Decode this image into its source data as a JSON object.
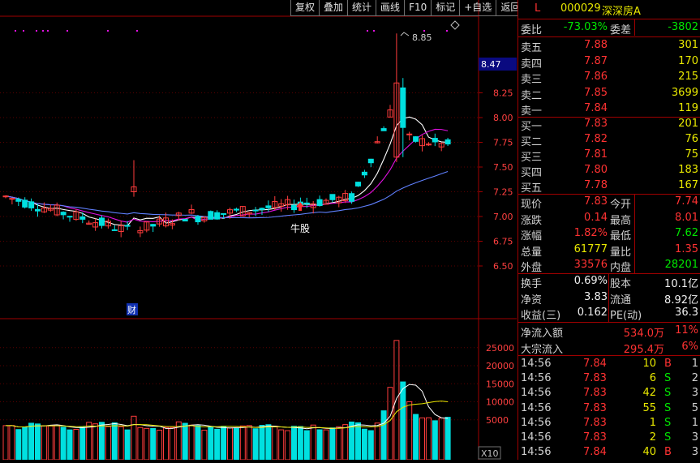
{
  "toolbar": {
    "items": [
      "复权",
      "叠加",
      "统计",
      "画线",
      "F10",
      "标记",
      "+自选",
      "返回"
    ]
  },
  "chart": {
    "price_axis": [
      "8.25",
      "8.00",
      "7.75",
      "7.50",
      "7.25",
      "7.00",
      "6.75",
      "6.50"
    ],
    "current_price_tag": "8.47",
    "high_label": "8.85",
    "annotation": "牛股",
    "marker_text": "财",
    "volume_axis": [
      "25000",
      "20000",
      "15000",
      "10000",
      "5000"
    ],
    "volume_unit": "X10",
    "colors": {
      "up": "#ff3c3c",
      "down": "#00e0e0",
      "ma5": "#ffffff",
      "ma10": "#e010e0",
      "ma20": "#6080ff"
    }
  },
  "quote": {
    "code": "000029",
    "name": "深深房A",
    "l_label": "L",
    "weibi": {
      "label": "委比",
      "value": "-73.03%",
      "label2": "委差",
      "value2": "-3802"
    },
    "asks": [
      {
        "label": "卖五",
        "price": "7.88",
        "vol": "301"
      },
      {
        "label": "卖四",
        "price": "7.87",
        "vol": "170"
      },
      {
        "label": "卖三",
        "price": "7.86",
        "vol": "215"
      },
      {
        "label": "卖二",
        "price": "7.85",
        "vol": "3699"
      },
      {
        "label": "卖一",
        "price": "7.84",
        "vol": "119"
      }
    ],
    "bids": [
      {
        "label": "买一",
        "price": "7.83",
        "vol": "201"
      },
      {
        "label": "买二",
        "price": "7.82",
        "vol": "76"
      },
      {
        "label": "买三",
        "price": "7.81",
        "vol": "75"
      },
      {
        "label": "买四",
        "price": "7.80",
        "vol": "183"
      },
      {
        "label": "买五",
        "price": "7.78",
        "vol": "167"
      }
    ],
    "stats": [
      {
        "l1": "现价",
        "v1": "7.83",
        "l2": "今开",
        "v2": "7.74"
      },
      {
        "l1": "涨跌",
        "v1": "0.14",
        "l2": "最高",
        "v2": "8.01"
      },
      {
        "l1": "涨幅",
        "v1": "1.82%",
        "l2": "最低",
        "v2": "7.62"
      },
      {
        "l1": "总量",
        "v1": "61777",
        "l2": "量比",
        "v2": "1.35"
      },
      {
        "l1": "外盘",
        "v1": "33576",
        "l2": "内盘",
        "v2": "28201"
      }
    ],
    "finance": [
      {
        "l1": "换手",
        "v1": "0.69%",
        "l2": "股本",
        "v2": "10.1亿"
      },
      {
        "l1": "净资",
        "v1": "3.83",
        "l2": "流通",
        "v2": "8.92亿"
      },
      {
        "l1": "收益(三)",
        "v1": "0.162",
        "l2": "PE(动)",
        "v2": "36.3"
      }
    ],
    "flows": [
      {
        "label": "净流入额",
        "value": "534.0万",
        "pct": "11%"
      },
      {
        "label": "大宗流入",
        "value": "295.4万",
        "pct": "6%"
      }
    ],
    "ticks": [
      {
        "time": "14:56",
        "price": "7.84",
        "vol": "10",
        "side": "B",
        "n": "1"
      },
      {
        "time": "14:56",
        "price": "7.83",
        "vol": "6",
        "side": "S",
        "n": "2"
      },
      {
        "time": "14:56",
        "price": "7.83",
        "vol": "42",
        "side": "S",
        "n": "3"
      },
      {
        "time": "14:56",
        "price": "7.83",
        "vol": "55",
        "side": "S",
        "n": "5"
      },
      {
        "time": "14:56",
        "price": "7.83",
        "vol": "1",
        "side": "S",
        "n": "1"
      },
      {
        "time": "14:56",
        "price": "7.83",
        "vol": "2",
        "side": "S",
        "n": "3"
      },
      {
        "time": "14:56",
        "price": "7.84",
        "vol": "40",
        "side": "B",
        "n": "3"
      }
    ]
  }
}
